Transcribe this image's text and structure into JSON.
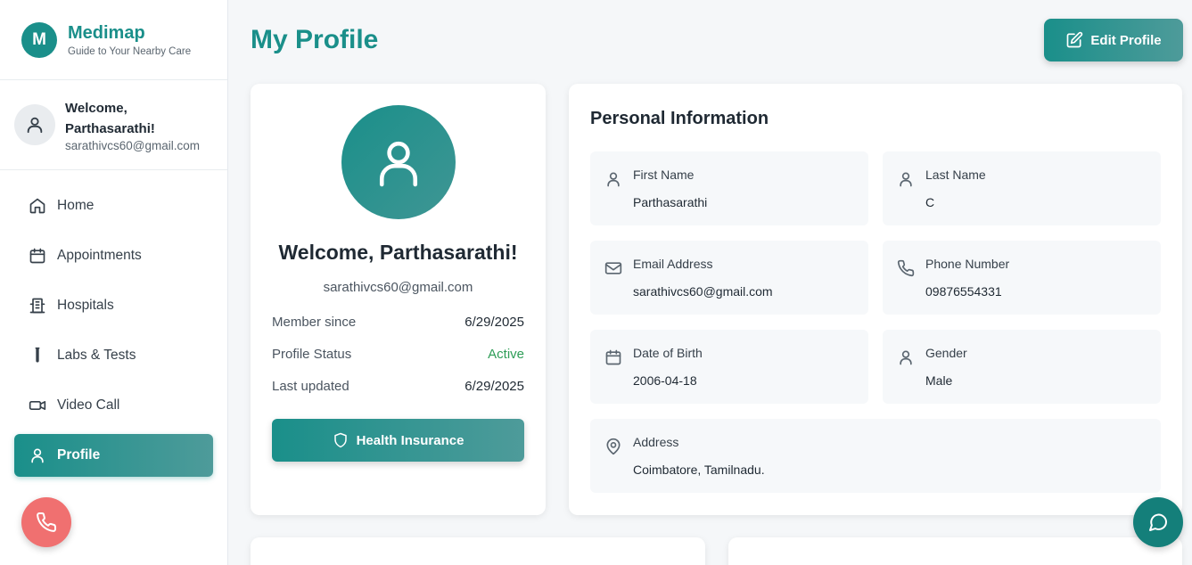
{
  "brand": {
    "logo_letter": "M",
    "name": "Medimap",
    "tagline": "Guide to Your Nearby Care"
  },
  "user": {
    "welcome": "Welcome, Parthasarathi!",
    "email": "sarathivcs60@gmail.com"
  },
  "nav": {
    "items": [
      {
        "label": "Home",
        "icon": "home-icon"
      },
      {
        "label": "Appointments",
        "icon": "calendar-icon"
      },
      {
        "label": "Hospitals",
        "icon": "building-icon"
      },
      {
        "label": "Labs & Tests",
        "icon": "test-tube-icon"
      },
      {
        "label": "Video Call",
        "icon": "video-icon"
      },
      {
        "label": "Profile",
        "icon": "user-icon",
        "active": true
      }
    ]
  },
  "page": {
    "title": "My Profile",
    "edit_label": "Edit Profile"
  },
  "profile_card": {
    "welcome": "Welcome, Parthasarathi!",
    "email": "sarathivcs60@gmail.com",
    "rows": [
      {
        "label": "Member since",
        "value": "6/29/2025"
      },
      {
        "label": "Profile Status",
        "value": "Active"
      },
      {
        "label": "Last updated",
        "value": "6/29/2025"
      }
    ],
    "insurance_label": "Health Insurance"
  },
  "personal_info": {
    "title": "Personal Information",
    "fields": [
      {
        "label": "First Name",
        "value": "Parthasarathi",
        "icon": "user-icon"
      },
      {
        "label": "Last Name",
        "value": "C",
        "icon": "user-icon"
      },
      {
        "label": "Email Address",
        "value": "sarathivcs60@gmail.com",
        "icon": "mail-icon"
      },
      {
        "label": "Phone Number",
        "value": "09876554331",
        "icon": "phone-icon"
      },
      {
        "label": "Date of Birth",
        "value": "2006-04-18",
        "icon": "calendar-icon"
      },
      {
        "label": "Gender",
        "value": "Male",
        "icon": "user-icon"
      },
      {
        "label": "Address",
        "value": "Coimbatore, Tamilnadu.",
        "icon": "map-pin-icon"
      }
    ]
  },
  "colors": {
    "brand": "#1a8f8a",
    "active_status": "#2e9d57",
    "call_fab": "#f07070",
    "chat_fab": "#147f7a"
  }
}
